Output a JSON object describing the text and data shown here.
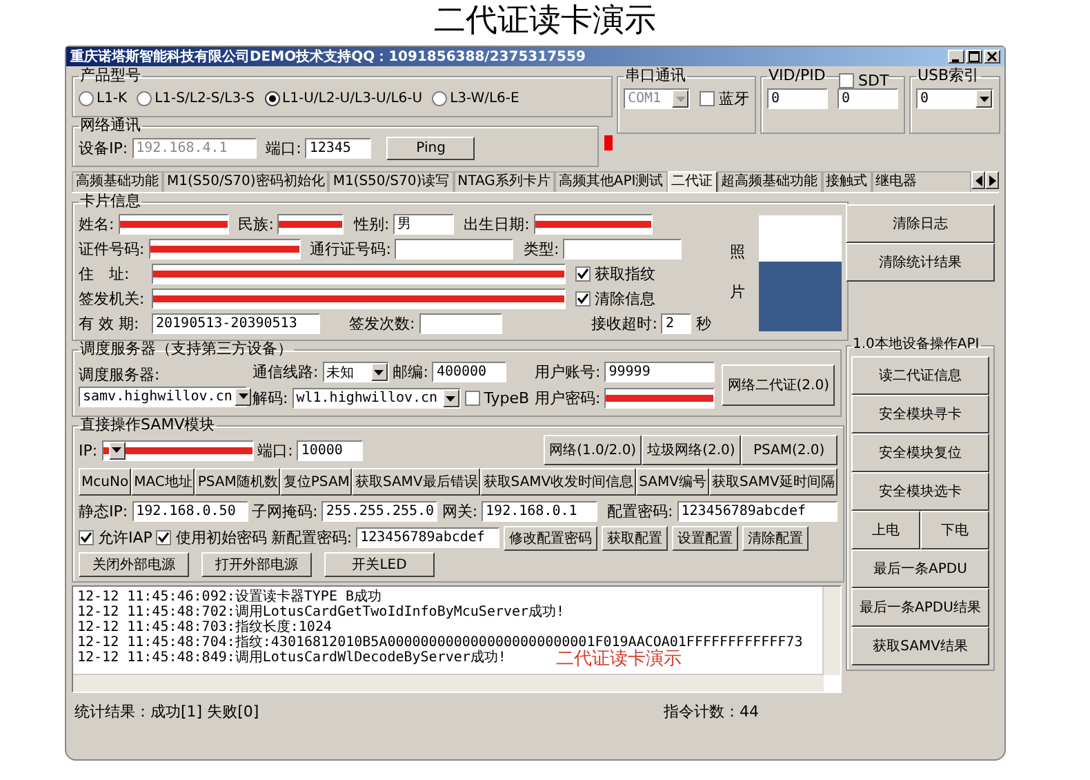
{
  "page_title": "二代证读卡演示",
  "window": {
    "title": "重庆诺塔斯智能科技有限公司DEMO技术支持QQ：1091856388/2375317559"
  },
  "product_model": {
    "label": "产品型号",
    "options": [
      {
        "label": "L1-K",
        "selected": false
      },
      {
        "label": "L1-S/L2-S/L3-S",
        "selected": false
      },
      {
        "label": "L1-U/L2-U/L3-U/L6-U",
        "selected": true
      },
      {
        "label": "L3-W/L6-E",
        "selected": false
      }
    ]
  },
  "serial": {
    "label": "串口通讯",
    "port": "COM1",
    "disabled": true,
    "bluetooth": {
      "label": "蓝牙",
      "checked": false
    }
  },
  "vid_pid": {
    "label": "VID/PID",
    "sdt": {
      "label": "SDT",
      "checked": false
    },
    "vid": "0",
    "pid": "0"
  },
  "usb_index": {
    "label": "USB索引",
    "value": "0"
  },
  "network": {
    "label": "网络通讯",
    "ip_label": "设备IP:",
    "ip": "192.168.4.1",
    "port_label": "端口:",
    "port": "12345",
    "ping": "Ping"
  },
  "tabs": [
    {
      "label": "高频基础功能",
      "selected": false
    },
    {
      "label": "M1(S50/S70)密码初始化",
      "selected": false
    },
    {
      "label": "M1(S50/S70)读写",
      "selected": false
    },
    {
      "label": "NTAG系列卡片",
      "selected": false
    },
    {
      "label": "高频其他API测试",
      "selected": false
    },
    {
      "label": "二代证",
      "selected": true
    },
    {
      "label": "超高频基础功能",
      "selected": false
    },
    {
      "label": "接触式",
      "selected": false
    },
    {
      "label": "继电器",
      "selected": false
    }
  ],
  "card_info": {
    "label": "卡片信息",
    "name": {
      "label": "姓名:",
      "redacted": true
    },
    "ethnicity": {
      "label": "民族:",
      "redacted": true
    },
    "gender": {
      "label": "性别:",
      "value": "男",
      "redacted": false
    },
    "birth": {
      "label": "出生日期:",
      "redacted": true
    },
    "id_number": {
      "label": "证件号码:",
      "redacted": true
    },
    "permit": {
      "label": "通行证号码:",
      "redacted": false
    },
    "type": {
      "label": "类型:",
      "redacted": false
    },
    "address": {
      "label": "住　址:",
      "redacted": true
    },
    "issuer": {
      "label": "签发机关:",
      "redacted": true
    },
    "validity": {
      "label": "有 效 期:",
      "value": "20190513-20390513",
      "redacted": false
    },
    "issue_count": {
      "label": "签发次数:",
      "redacted": false
    },
    "fingerprint": {
      "label": "获取指纹",
      "checked": true
    },
    "clear_info": {
      "label": "清除信息",
      "checked": true
    },
    "timeout_label": "接收超时:",
    "timeout": "2",
    "timeout_unit": "秒",
    "photo_label": "照片"
  },
  "side_buttons": [
    "清除日志",
    "清除统计结果"
  ],
  "dispatch": {
    "label": "调度服务器（支持第三方设备）",
    "server_label": "调度服务器:",
    "server": "samv.highwillov.cn",
    "line_label": "通信线路:",
    "line": "未知",
    "zip_label": "邮编:",
    "zip": "400000",
    "account_label": "用户账号:",
    "account": "99999",
    "decode_label": "解码:",
    "decode": "wl1.highwillov.cn",
    "typeb": {
      "label": "TypeB",
      "checked": false
    },
    "password_label": "用户密码:",
    "password_redacted": true,
    "button": "网络二代证(2.0)"
  },
  "samv": {
    "label": "直接操作SAMV模块",
    "ip_label": "IP:",
    "ip_redacted": true,
    "port_label": "端口:",
    "port": "10000",
    "net_buttons": [
      "网络(1.0/2.0)",
      "垃圾网络(2.0)",
      "PSAM(2.0)"
    ],
    "cmd_buttons": [
      "McuNo",
      "MAC地址",
      "PSAM随机数",
      "复位PSAM",
      "获取SAMV最后错误",
      "获取SAMV收发时间信息",
      "SAMV编号",
      "获取SAMV延时间隔"
    ],
    "static_ip_label": "静态IP:",
    "static_ip": "192.168.0.50",
    "mask_label": "子网掩码:",
    "mask": "255.255.255.0",
    "gateway_label": "网关:",
    "gateway": "192.168.0.1",
    "cfg_pwd_label": "配置密码:",
    "cfg_pwd": "123456789abcdef",
    "allow_iap": {
      "label": "允许IAP",
      "checked": true
    },
    "use_init_pwd": {
      "label": "使用初始密码",
      "checked": true
    },
    "new_pwd_label": "新配置密码:",
    "new_pwd": "123456789abcdef",
    "cfg_buttons": [
      "修改配置密码",
      "获取配置",
      "设置配置",
      "清除配置"
    ],
    "power_buttons": [
      "关闭外部电源",
      "打开外部电源",
      "开关LED"
    ]
  },
  "local_api": {
    "label": "1.0本地设备操作API",
    "buttons": [
      {
        "label": "读二代证信息",
        "kind": "full"
      },
      {
        "label": "安全模块寻卡",
        "kind": "full"
      },
      {
        "label": "安全模块复位",
        "kind": "full"
      },
      {
        "label": "安全模块选卡",
        "kind": "full"
      },
      {
        "label": "上电",
        "kind": "half"
      },
      {
        "label": "下电",
        "kind": "half"
      },
      {
        "label": "最后一条APDU",
        "kind": "full"
      },
      {
        "label": "最后一条APDU结果",
        "kind": "full"
      },
      {
        "label": "获取SAMV结果",
        "kind": "full"
      }
    ]
  },
  "log": {
    "lines": [
      "12-12 11:45:46:092:设置读卡器TYPE B成功",
      "12-12 11:45:48:702:调用LotusCardGetTwoIdInfoByMcuServer成功!",
      "12-12 11:45:48:703:指纹长度:1024",
      "12-12 11:45:48:704:指纹:43016812010B5A0000000000000000000000001F019AACOA01FFFFFFFFFFFF73",
      "12-12 11:45:48:849:调用LotusCardWlDecodeByServer成功!"
    ],
    "caption": "二代证读卡演示"
  },
  "status": {
    "stats": "统计结果：成功[1] 失败[0]",
    "count_label": "指令计数：",
    "count": "44"
  }
}
